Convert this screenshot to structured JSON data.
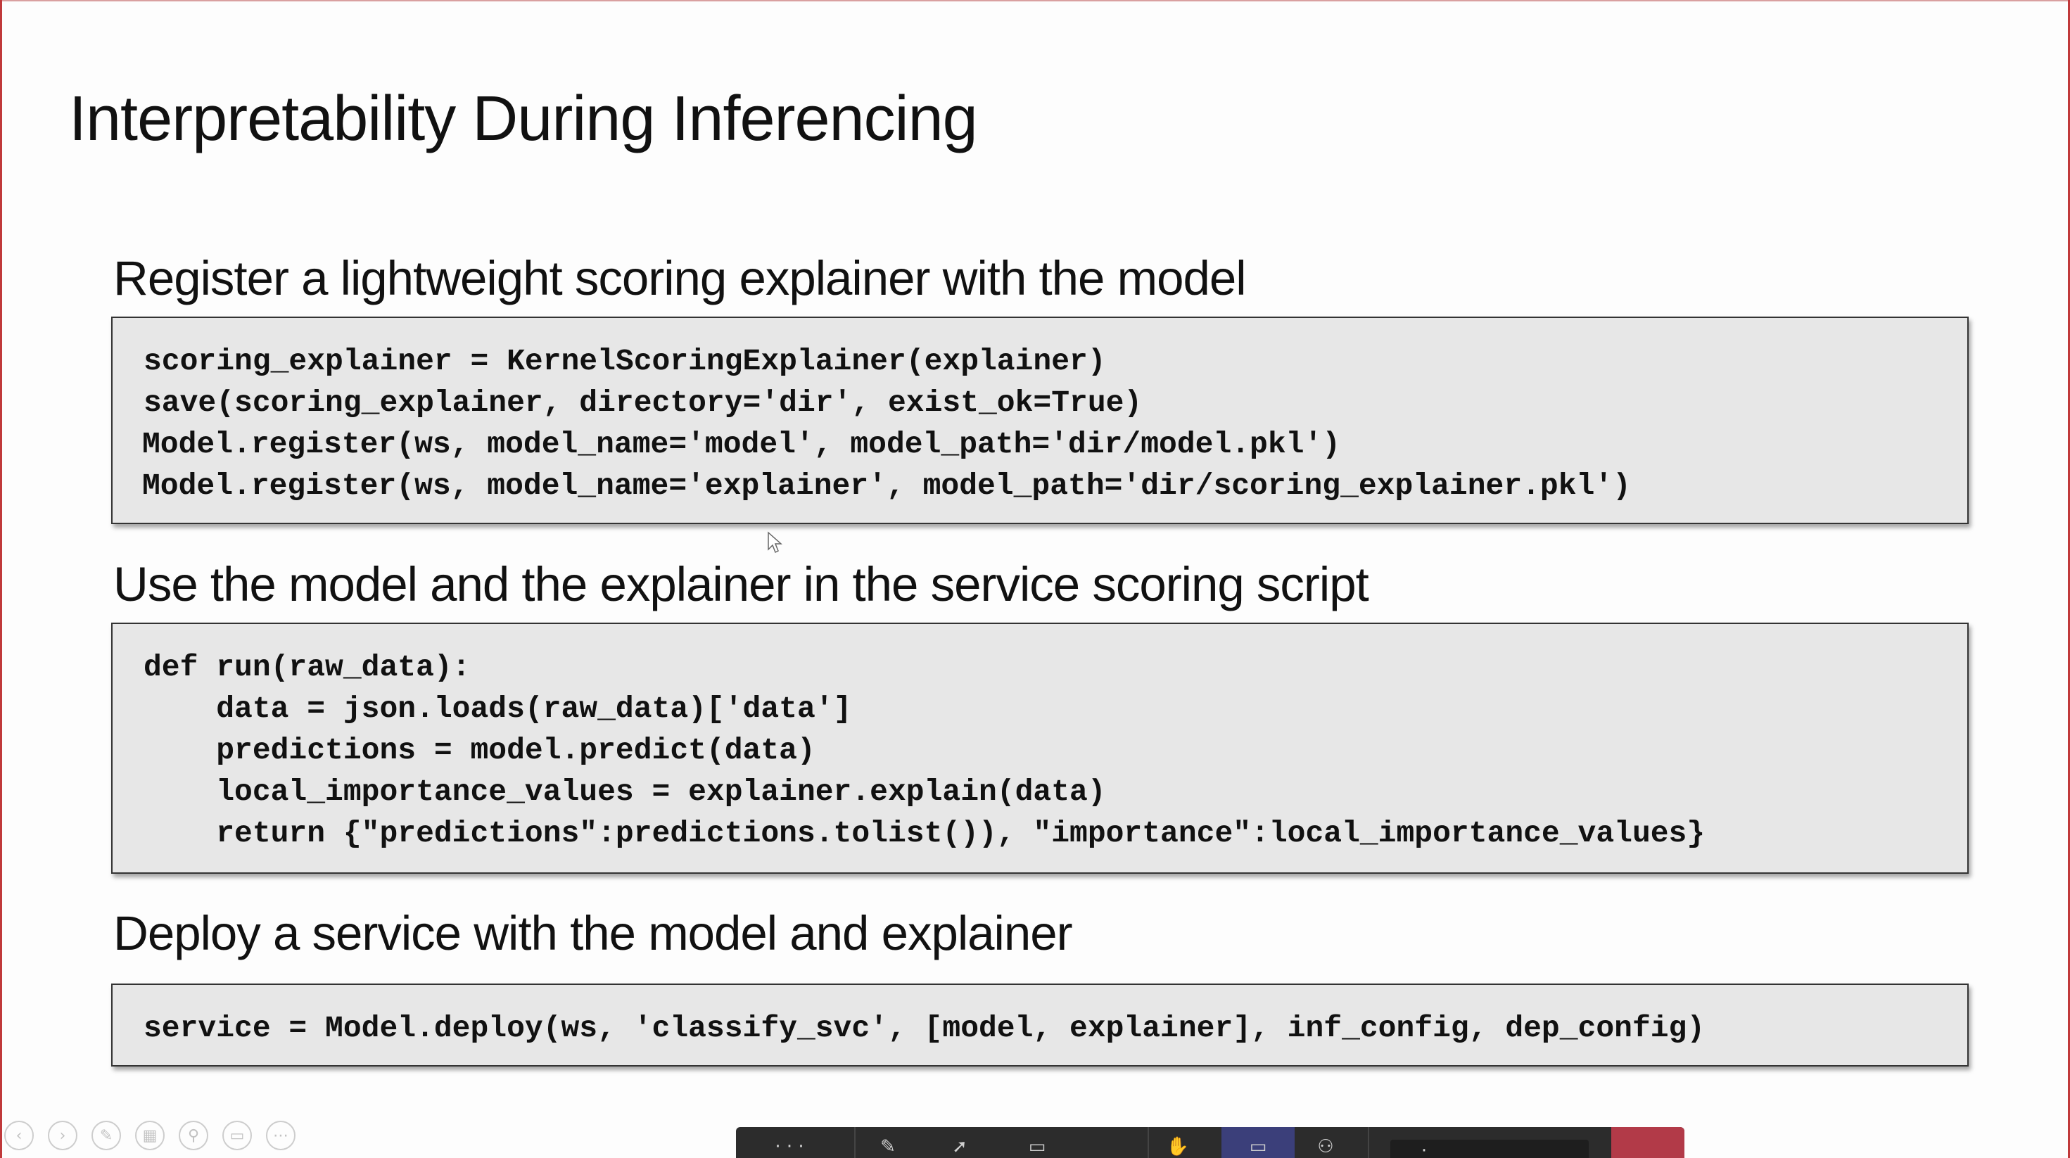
{
  "slide": {
    "title": "Interpretability During Inferencing",
    "sections": [
      {
        "heading": "Register a lightweight scoring explainer with the model",
        "code": [
          "scoring_explainer = KernelScoringExplainer(explainer)",
          "save(scoring_explainer, directory='dir', exist_ok=True)",
          "Model.register(ws, model_name='model', model_path='dir/model.pkl')",
          "Model.register(ws, model_name='explainer', model_path='dir/scoring_explainer.pkl')"
        ]
      },
      {
        "heading": "Use the model and the explainer in the service scoring script",
        "code": [
          "def run(raw_data):",
          "    data = json.loads(raw_data)['data']",
          "    predictions = model.predict(data)",
          "    local_importance_values = explainer.explain(data)",
          "    return {\"predictions\":predictions.tolist()), \"importance\":local_importance_values}"
        ]
      },
      {
        "heading": "Deploy a service with the model and explainer",
        "code": [
          "service = Model.deploy(ws, 'classify_svc', [model, explainer], inf_config, dep_config)"
        ]
      }
    ]
  },
  "nav_controls": [
    {
      "icon": "previous-icon"
    },
    {
      "icon": "next-icon"
    },
    {
      "icon": "pen-icon"
    },
    {
      "icon": "see-all-slides-icon"
    },
    {
      "icon": "zoom-icon"
    },
    {
      "icon": "screen-icon"
    },
    {
      "icon": "more-options-icon"
    }
  ],
  "toolbar": {
    "icons": [
      "timer-icon",
      "pen-icon",
      "laser-pointer-icon",
      "subtitles-icon",
      "hand-icon",
      "chat-icon",
      "participants-icon",
      "share-tray-icon",
      "leave-icon"
    ],
    "colors": {
      "background": "#2c2c2c",
      "active": "#3b3f7a",
      "leave": "#b23a48"
    }
  }
}
